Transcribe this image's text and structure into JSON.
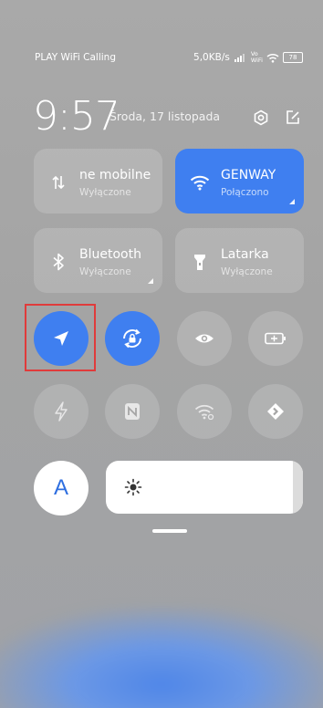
{
  "status_bar": {
    "carrier": "PLAY WiFi Calling",
    "speed": "5,0KB/s",
    "volte_top": "Vo",
    "volte_bottom": "WiFi",
    "battery": "78"
  },
  "header": {
    "time": "9:57",
    "date": "Środa, 17 listopada"
  },
  "tiles": [
    {
      "title": "ne mobilne",
      "subtitle": "Wyłączone",
      "icon": "mobile-data-arrows-icon",
      "active": false
    },
    {
      "title": "GENWAY",
      "subtitle": "Połączono",
      "icon": "wifi-icon",
      "active": true
    },
    {
      "title": "Bluetooth",
      "subtitle": "Wyłączone",
      "icon": "bluetooth-icon",
      "active": false
    },
    {
      "title": "Latarka",
      "subtitle": "Wyłączone",
      "icon": "flashlight-icon",
      "active": false
    }
  ],
  "toggles_row1": [
    {
      "icon": "location-arrow-icon",
      "active": true
    },
    {
      "icon": "rotation-lock-icon",
      "active": true
    },
    {
      "icon": "eye-icon",
      "active": false
    },
    {
      "icon": "battery-saver-icon",
      "active": false
    }
  ],
  "toggles_row2": [
    {
      "icon": "flash-icon",
      "active": false
    },
    {
      "icon": "nfc-icon",
      "active": false
    },
    {
      "icon": "wifi-hotspot-icon",
      "active": false
    },
    {
      "icon": "screen-cast-icon",
      "active": false
    }
  ],
  "auto_brightness_label": "A",
  "brightness_level": 0.95,
  "colors": {
    "accent": "#3f7ff0",
    "highlight": "#e03b3b"
  }
}
